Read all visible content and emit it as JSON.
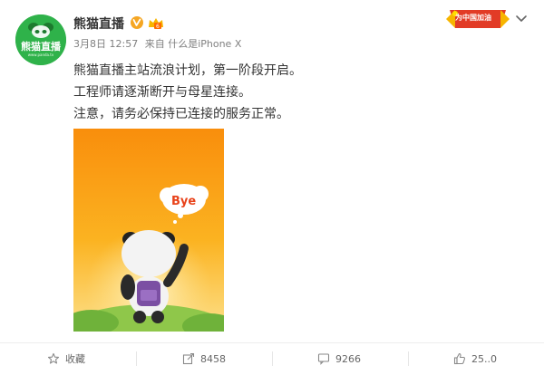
{
  "post": {
    "author": "熊猫直播",
    "avatar_text": "熊猫直播",
    "avatar_sub": "www.panda.tv",
    "date": "3月8日 12:57",
    "source": "来自 什么是iPhone X",
    "lines": [
      "熊猫直播主站流浪计划，第一阶段开启。",
      "工程师请逐渐断开与母星连接。",
      "注意，请务必保持已连接的服务正常。"
    ],
    "image_text": "Bye"
  },
  "badge": {
    "label": "为中国加油"
  },
  "actions": {
    "favorite": "收藏",
    "repost": "8458",
    "comment": "9266",
    "like": "25..0"
  },
  "colors": {
    "brand_green": "#2fb24a",
    "verify_blue": "#f5a623",
    "orange_bg": "#f9a11b"
  }
}
